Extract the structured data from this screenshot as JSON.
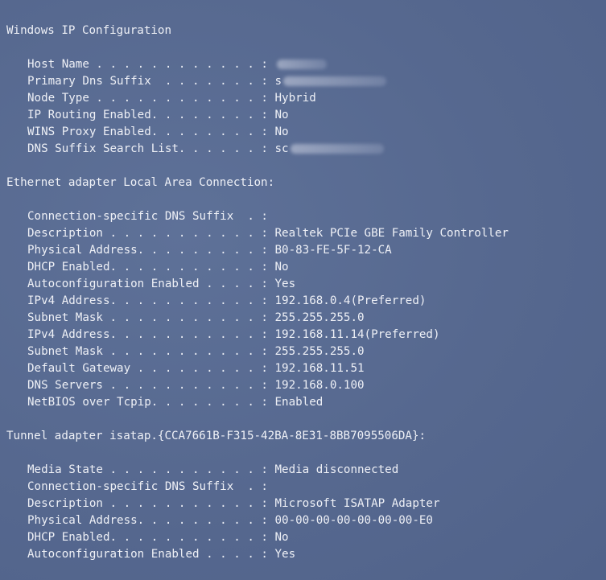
{
  "sections": [
    {
      "header": "Windows IP Configuration",
      "entries": [
        {
          "label": "Host Name . . . . . . . . . . . . : ",
          "value": ""
        },
        {
          "label": "Primary Dns Suffix  . . . . . . . : ",
          "value": "s"
        },
        {
          "label": "Node Type . . . . . . . . . . . . : ",
          "value": "Hybrid"
        },
        {
          "label": "IP Routing Enabled. . . . . . . . : ",
          "value": "No"
        },
        {
          "label": "WINS Proxy Enabled. . . . . . . . : ",
          "value": "No"
        },
        {
          "label": "DNS Suffix Search List. . . . . . : ",
          "value": "sc"
        }
      ]
    },
    {
      "header": "Ethernet adapter Local Area Connection:",
      "entries": [
        {
          "label": "Connection-specific DNS Suffix  . : ",
          "value": ""
        },
        {
          "label": "Description . . . . . . . . . . . : ",
          "value": "Realtek PCIe GBE Family Controller"
        },
        {
          "label": "Physical Address. . . . . . . . . : ",
          "value": "B0-83-FE-5F-12-CA"
        },
        {
          "label": "DHCP Enabled. . . . . . . . . . . : ",
          "value": "No"
        },
        {
          "label": "Autoconfiguration Enabled . . . . : ",
          "value": "Yes"
        },
        {
          "label": "IPv4 Address. . . . . . . . . . . : ",
          "value": "192.168.0.4(Preferred)"
        },
        {
          "label": "Subnet Mask . . . . . . . . . . . : ",
          "value": "255.255.255.0"
        },
        {
          "label": "IPv4 Address. . . . . . . . . . . : ",
          "value": "192.168.11.14(Preferred)"
        },
        {
          "label": "Subnet Mask . . . . . . . . . . . : ",
          "value": "255.255.255.0"
        },
        {
          "label": "Default Gateway . . . . . . . . . : ",
          "value": "192.168.11.51"
        },
        {
          "label": "DNS Servers . . . . . . . . . . . : ",
          "value": "192.168.0.100"
        },
        {
          "label": "NetBIOS over Tcpip. . . . . . . . : ",
          "value": "Enabled"
        }
      ]
    },
    {
      "header": "Tunnel adapter isatap.{CCA7661B-F315-42BA-8E31-8BB7095506DA}:",
      "entries": [
        {
          "label": "Media State . . . . . . . . . . . : ",
          "value": "Media disconnected"
        },
        {
          "label": "Connection-specific DNS Suffix  . : ",
          "value": ""
        },
        {
          "label": "Description . . . . . . . . . . . : ",
          "value": "Microsoft ISATAP Adapter"
        },
        {
          "label": "Physical Address. . . . . . . . . : ",
          "value": "00-00-00-00-00-00-00-E0"
        },
        {
          "label": "DHCP Enabled. . . . . . . . . . . : ",
          "value": "No"
        },
        {
          "label": "Autoconfiguration Enabled . . . . : ",
          "value": "Yes"
        }
      ]
    }
  ]
}
